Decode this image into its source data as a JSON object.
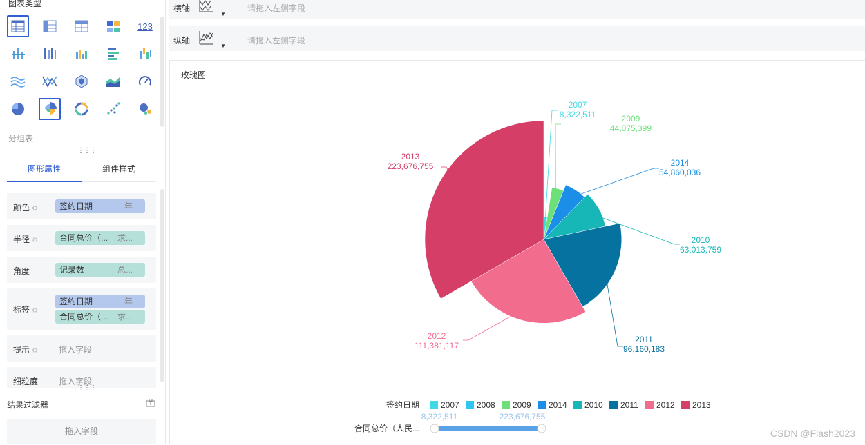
{
  "sidebar": {
    "chart_type_title": "图表类型",
    "sub_label": "分组表",
    "tabs": [
      {
        "label": "图形属性"
      },
      {
        "label": "组件样式"
      }
    ],
    "props": {
      "color": {
        "label": "颜色",
        "field": "签约日期",
        "agg": "年"
      },
      "radius": {
        "label": "半径",
        "field": "合同总价（...",
        "agg": "求..."
      },
      "angle": {
        "label": "角度",
        "field": "记录数",
        "agg": "总..."
      },
      "tags": {
        "label": "标签",
        "field1": "签约日期",
        "agg1": "年",
        "field2": "合同总价（...",
        "agg2": "求..."
      },
      "tooltip": {
        "label": "提示",
        "placeholder": "拖入字段"
      },
      "granularity": {
        "label": "细粒度",
        "placeholder": "拖入字段"
      }
    },
    "filter": {
      "title": "结果过滤器",
      "placeholder": "拖入字段"
    }
  },
  "axes": {
    "x": {
      "label": "横轴",
      "placeholder": "请拖入左侧字段"
    },
    "y": {
      "label": "纵轴",
      "placeholder": "请拖入左侧字段"
    }
  },
  "chart_title": "玫瑰图",
  "watermark": "CSDN @Flash2023",
  "chart_data": {
    "type": "pie",
    "variant": "rose",
    "categories": [
      "2007",
      "2008",
      "2009",
      "2010",
      "2011",
      "2012",
      "2013",
      "2014"
    ],
    "values": [
      8322511,
      null,
      44075399,
      63013759,
      96160183,
      111381117,
      223676755,
      54860036
    ],
    "labels": [
      "8,322,511",
      "",
      "44,075,399",
      "63,013,759",
      "96,160,183",
      "111,381,117",
      "223,676,755",
      "54,860,036"
    ],
    "legend_title": "签约日期",
    "legend_order": [
      "2007",
      "2008",
      "2009",
      "2014",
      "2010",
      "2011",
      "2012",
      "2013"
    ],
    "colors": {
      "2007": "#3fd9e6",
      "2008": "#32c5f0",
      "2009": "#6ee07a",
      "2010": "#17b7b8",
      "2011": "#0672a0",
      "2012": "#f26d8d",
      "2013": "#d43e67",
      "2014": "#1b8fe8"
    },
    "size_legend": {
      "title": "合同总价（人民...",
      "min": "8,322,511",
      "max": "223,676,755"
    }
  }
}
